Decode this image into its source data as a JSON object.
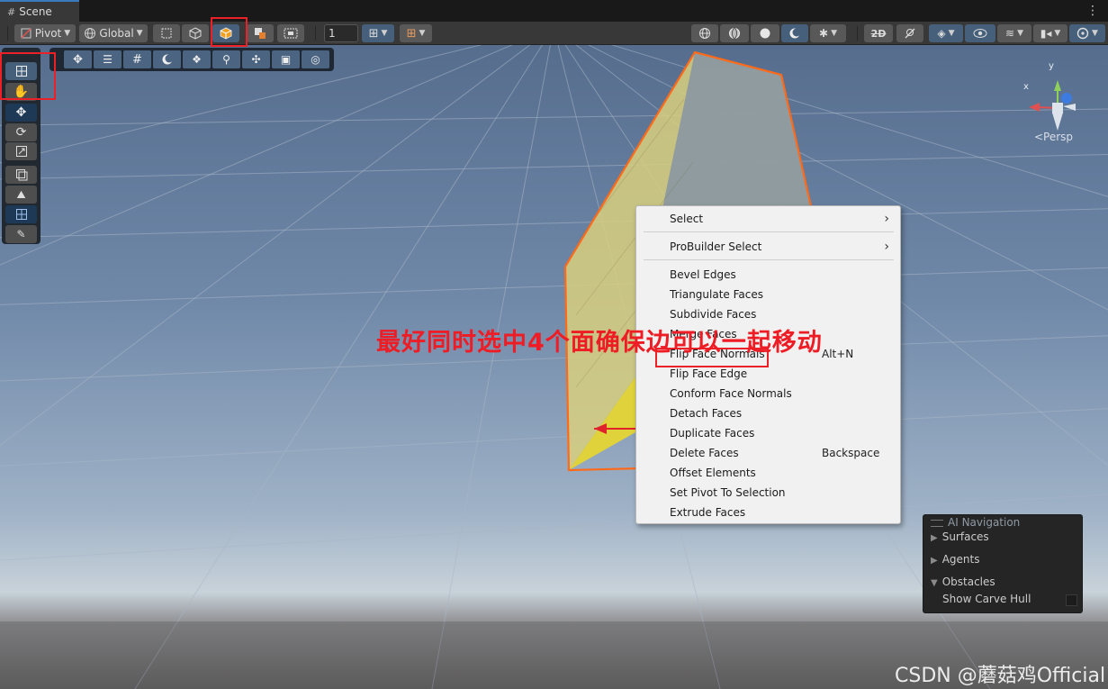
{
  "tab": {
    "label": "Scene"
  },
  "toolbar": {
    "pivot_label": "Pivot",
    "global_label": "Global",
    "grid_size_value": "1"
  },
  "gizmo": {
    "x_label": "x",
    "y_label": "y",
    "persp_label": "<Persp"
  },
  "annotation": "最好同时选中4个面确保边可以一起移动",
  "context_menu": {
    "items": [
      {
        "label": "Select",
        "submenu": true
      },
      {
        "label": "ProBuilder Select",
        "submenu": true
      },
      {
        "label": "Bevel Edges"
      },
      {
        "label": "Triangulate Faces"
      },
      {
        "label": "Subdivide Faces"
      },
      {
        "label": "Merge Faces"
      },
      {
        "label": "Flip Face Normals",
        "shortcut": "Alt+N"
      },
      {
        "label": "Flip Face Edge"
      },
      {
        "label": "Conform Face Normals"
      },
      {
        "label": "Detach Faces"
      },
      {
        "label": "Duplicate Faces"
      },
      {
        "label": "Delete Faces",
        "shortcut": "Backspace"
      },
      {
        "label": "Offset Elements"
      },
      {
        "label": "Set Pivot To Selection"
      },
      {
        "label": "Extrude Faces"
      }
    ]
  },
  "ai_navigation": {
    "title": "AI Navigation",
    "surfaces": "Surfaces",
    "agents": "Agents",
    "obstacles": "Obstacles",
    "show_carve_hull": "Show Carve Hull"
  },
  "watermark": "CSDN @蘑菇鸡Official",
  "colors": {
    "highlight_red": "#ec2128",
    "selected_face_yellow": "#d8cf7e",
    "selection_outline": "#ff6a1a",
    "toolbar_active": "#46607c"
  }
}
